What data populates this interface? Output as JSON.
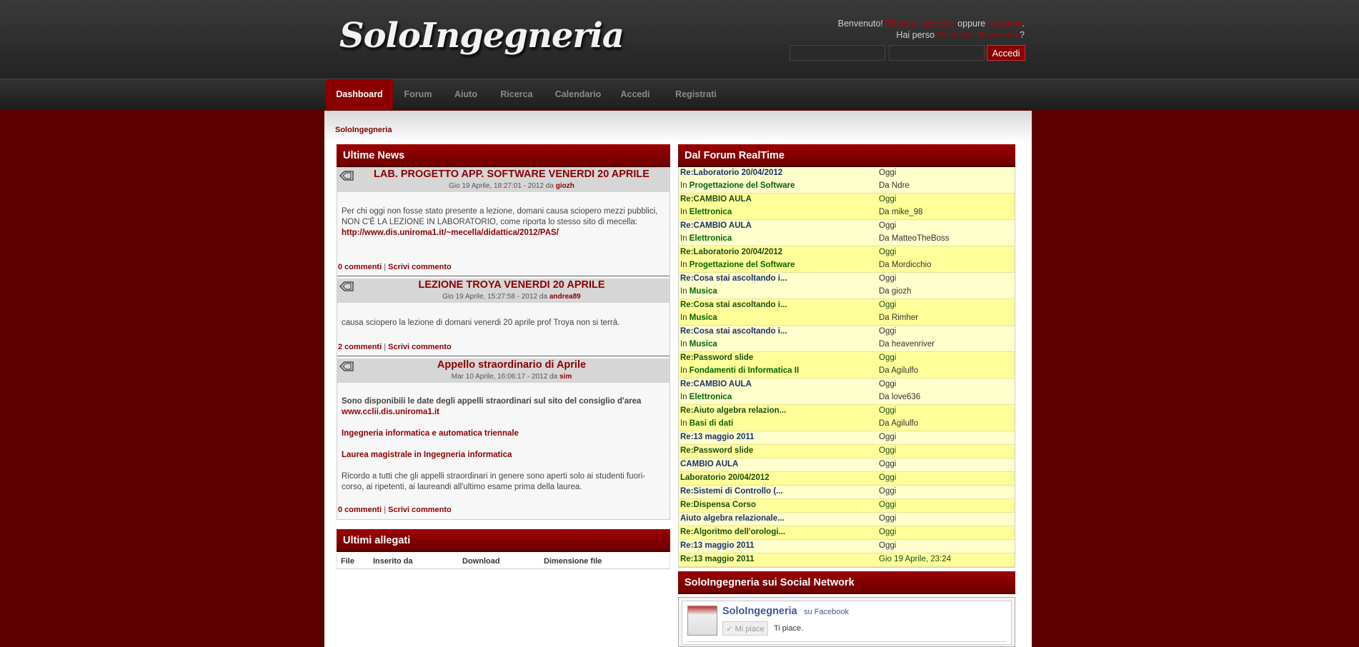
{
  "header": {
    "logo": "SoloIngegneria",
    "welcome_prefix": "Benvenuto! ",
    "welcome_login_link": "Effettua l'accesso",
    "welcome_mid": " oppure ",
    "welcome_register_link": "registrati",
    "welcome_suffix": ".",
    "lost_prefix": "Hai perso ",
    "lost_link": "l'e-mail di attivazione",
    "lost_suffix": "?",
    "login_button": "Accedi"
  },
  "nav": {
    "items": [
      "Dashboard",
      "Forum",
      "Aiuto",
      "Ricerca",
      "Calendario",
      "Accedi",
      "Registrati"
    ]
  },
  "breadcrumb": "SoloIngegneria",
  "news": {
    "heading": "Ultime News",
    "items": [
      {
        "title": "LAB. PROGETTO APP. SOFTWARE VENERDI 20 APRILE",
        "meta": "Gio 19 Aprile, 18:27:01 - 2012 da ",
        "author": "giozh",
        "body": "Per chi oggi non fosse stato presente a lezione, domani causa sciopero mezzi pubblici, NON C'È LA LEZIONE IN LABORATORIO, come riporta lo stesso sito di mecella:",
        "link": "http://www.dis.uniroma1.it/~mecella/didattica/2012/PAS/",
        "comments": "0 commenti",
        "write": "Scrivi commento"
      },
      {
        "title": "LEZIONE TROYA VENERDI 20 APRILE",
        "meta": "Gio 19 Aprile, 15:27:58 - 2012 da ",
        "author": "andrea89",
        "body": "causa sciopero la lezione di domani venerdi 20 aprile prof Troya  non si terrà.",
        "comments": "2 commenti",
        "write": "Scrivi commento"
      },
      {
        "title": "Appello straordinario di Aprile",
        "meta": "Mar 10 Aprile, 16:06:17 - 2012 da ",
        "author": "sim",
        "body_bold": "Sono disponibili le date degli appelli straordinari sul sito del consiglio d'area",
        "link": "www.cclii.dis.uniroma1.it",
        "link2": "Ingegneria informatica e automatica triennale",
        "link3": "Laurea magistrale in Ingegneria informatica",
        "body2": "Ricordo a tutti che gli appelli straordinari in genere sono aperti solo ai studenti fuori-corso, ai ripetenti, ai laureandi all'ultimo esame prima della laurea.",
        "comments": "0 commenti",
        "write": "Scrivi commento"
      }
    ],
    "separator": " | "
  },
  "attachments": {
    "heading": "Ultimi allegati",
    "columns": [
      "File",
      "Inserito da",
      "Download",
      "Dimensione file"
    ]
  },
  "realtime": {
    "heading": "Dal Forum RealTime",
    "in_label": "In ",
    "by_label": "Da ",
    "rows": [
      {
        "title": "Re:Laboratorio 20/04/2012",
        "board": "Progettazione del Software",
        "date": "Oggi",
        "user": "Ndre"
      },
      {
        "title": "Re:CAMBIO AULA",
        "board": "Elettronica",
        "date": "Oggi",
        "user": "mike_98"
      },
      {
        "title": "Re:CAMBIO AULA",
        "board": "Elettronica",
        "date": "Oggi",
        "user": "MatteoTheBoss"
      },
      {
        "title": "Re:Laboratorio 20/04/2012",
        "board": "Progettazione del Software",
        "date": "Oggi",
        "user": "Mordicchio"
      },
      {
        "title": "Re:Cosa stai ascoltando i...",
        "board": "Musica",
        "date": "Oggi",
        "user": "giozh"
      },
      {
        "title": "Re:Cosa stai ascoltando i...",
        "board": "Musica",
        "date": "Oggi",
        "user": "Rimher"
      },
      {
        "title": "Re:Cosa stai ascoltando i...",
        "board": "Musica",
        "date": "Oggi",
        "user": "heavenriver"
      },
      {
        "title": "Re:Password slide",
        "board": "Fondamenti di Informatica II",
        "date": "Oggi",
        "user": "Agilulfo"
      },
      {
        "title": "Re:CAMBIO AULA",
        "board": "Elettronica",
        "date": "Oggi",
        "user": "love636"
      },
      {
        "title": "Re:Aiuto algebra relazion...",
        "board": "Basi di dati",
        "date": "Oggi",
        "user": "Agilulfo"
      }
    ],
    "short_rows": [
      {
        "title": "Re:13 maggio 2011",
        "date": "Oggi"
      },
      {
        "title": "Re:Password slide",
        "date": "Oggi"
      },
      {
        "title": "CAMBIO AULA",
        "date": "Oggi"
      },
      {
        "title": "Laboratorio 20/04/2012",
        "date": "Oggi"
      },
      {
        "title": "Re:Sistemi di Controllo (...",
        "date": "Oggi"
      },
      {
        "title": "Re:Dispensa Corso",
        "date": "Oggi"
      },
      {
        "title": "Aiuto algebra relazionale...",
        "date": "Oggi"
      },
      {
        "title": "Re:Algoritmo dell'orologi...",
        "date": "Oggi"
      },
      {
        "title": "Re:13 maggio 2011",
        "date": "Oggi"
      },
      {
        "title": "Re:13 maggio 2011",
        "date": "Gio 19 Aprile, 23:24"
      }
    ]
  },
  "social": {
    "heading": "SoloIngegneria sui Social Network",
    "page_name": "SoloIngegneria",
    "on_facebook": "su Facebook",
    "like_button": "✓ Mi piace",
    "likes_text": "Ti piace."
  }
}
